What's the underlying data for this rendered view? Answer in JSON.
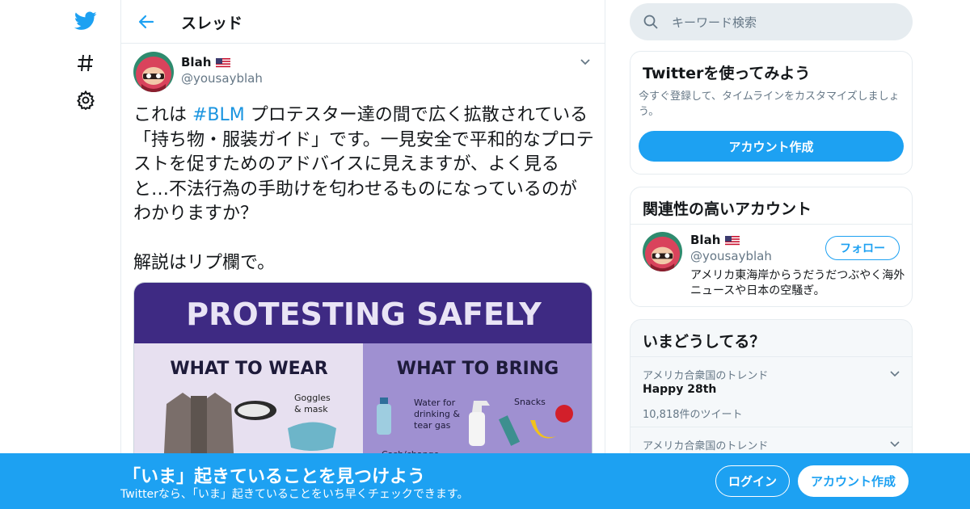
{
  "colors": {
    "brand": "#1da1f2",
    "hashtag": "#1b95e0",
    "secondary_text": "#657786",
    "border": "#e6ecf0"
  },
  "leftnav": {
    "icons": [
      "twitter-bird-icon",
      "hashtag-icon",
      "gear-icon"
    ]
  },
  "thread": {
    "back_icon": "back-arrow-icon",
    "title": "スレッド"
  },
  "tweet": {
    "author_name": "Blah",
    "author_flag": "us-flag",
    "author_handle": "@yousayblah",
    "text_pre": "これは ",
    "hashtag": "#BLM",
    "text_post": " プロテスター達の間で広く拡散されている「持ち物・服装ガイド」です。一見安全で平和的なプロテストを促すためのアドバイスに見えますが、よく見ると…不法行為の手助けを匂わせるものになっているのがわかりますか？\n\n解説はリプ欄で。",
    "image": {
      "title": "PROTESTING SAFELY",
      "left_heading": "WHAT TO WEAR",
      "right_heading": "WHAT TO BRING",
      "labels": {
        "goggles": "Goggles\n& mask",
        "water": "Water for\ndrinking &\ntear gas",
        "snacks": "Snacks",
        "cash": "Cash/change"
      }
    }
  },
  "search": {
    "placeholder": "キーワード検索"
  },
  "signup_card": {
    "title": "Twitterを使ってみよう",
    "description": "今すぐ登録して、タイムラインをカスタマイズしましょう。",
    "button": "アカウント作成"
  },
  "related_card": {
    "title": "関連性の高いアカウント",
    "name": "Blah",
    "handle": "@yousayblah",
    "follow_button": "フォロー",
    "bio": "アメリカ東海岸からうだうだつぶやく海外ニュースや日本の空騒ぎ。"
  },
  "trends_card": {
    "title": "いまどうしてる？",
    "items": [
      {
        "meta": "アメリカ合衆国のトレンド",
        "name": "Happy 28th",
        "count": "10,818件のツイート"
      },
      {
        "meta": "アメリカ合衆国のトレンド",
        "name": "",
        "count": ""
      }
    ]
  },
  "banner": {
    "title": "「いま」起きていることを見つけよう",
    "subtitle": "Twitterなら、「いま」起きていることをいち早くチェックできます。",
    "login": "ログイン",
    "signup": "アカウント作成"
  }
}
